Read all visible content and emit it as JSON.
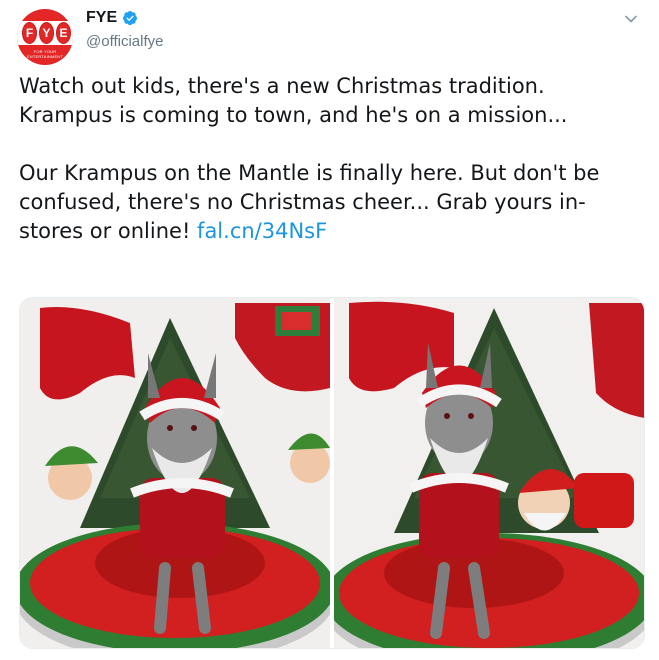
{
  "author": {
    "name": "FYE",
    "handle": "@officialfye",
    "verified": true,
    "avatar_letters": [
      "F",
      "Y",
      "E"
    ],
    "avatar_tagline": "FOR YOUR ENTERTAINMENT",
    "brand_color": "#e32626"
  },
  "tweet": {
    "text_main": "Watch out kids, there's a new Christmas tradition. Krampus is coming to town, and he's on a mission...\n\nOur Krampus on the Mantle is finally here. But don't be confused, there's no Christmas cheer... Grab yours in-stores or online!  ",
    "link": "fal.cn/34NsF",
    "link_color": "#1b95e0"
  },
  "icons": {
    "verified": "verified-badge-icon",
    "menu": "chevron-down-icon"
  },
  "media": {
    "count": 2
  }
}
